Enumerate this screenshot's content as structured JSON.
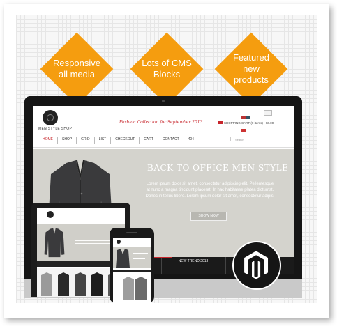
{
  "features": [
    {
      "line1": "Responsive",
      "line2": "all media",
      "line3": ""
    },
    {
      "line1": "Lots of CMS",
      "line2": "Blocks",
      "line3": ""
    },
    {
      "line1": "Featured",
      "line2": "new",
      "line3": "products"
    }
  ],
  "colors": {
    "accent": "#f59d0f",
    "brand_red": "#c7252b",
    "screen_bezel": "#151515"
  },
  "site": {
    "name": "MEN STYLE SHOP",
    "tagline": "Fashion Collection for September 2013",
    "cart": "SHOPPING CART (0 items) - $0.00",
    "nav": [
      "HOME",
      "SHOP",
      "GRID",
      "LIST",
      "CHECKOUT",
      "CART",
      "CONTACT",
      "404"
    ],
    "search_placeholder": "Search",
    "banner_title": "BACK TO OFFICE MEN STYLE",
    "banner_body": "Lorem ipsum dolor sit amet, consectetur adipiscing elit. Pellentesque at nunc a magna tincidunt placerat. In hac habitasse platea dictumst. Donec in tellus libero. Lorem ipsum dolor sit amet, consectetur adipis.",
    "shop_button": "SHOW NOW",
    "strip_label": "NEW TREND 2013"
  },
  "badge_icon": "magento-logo-icon"
}
